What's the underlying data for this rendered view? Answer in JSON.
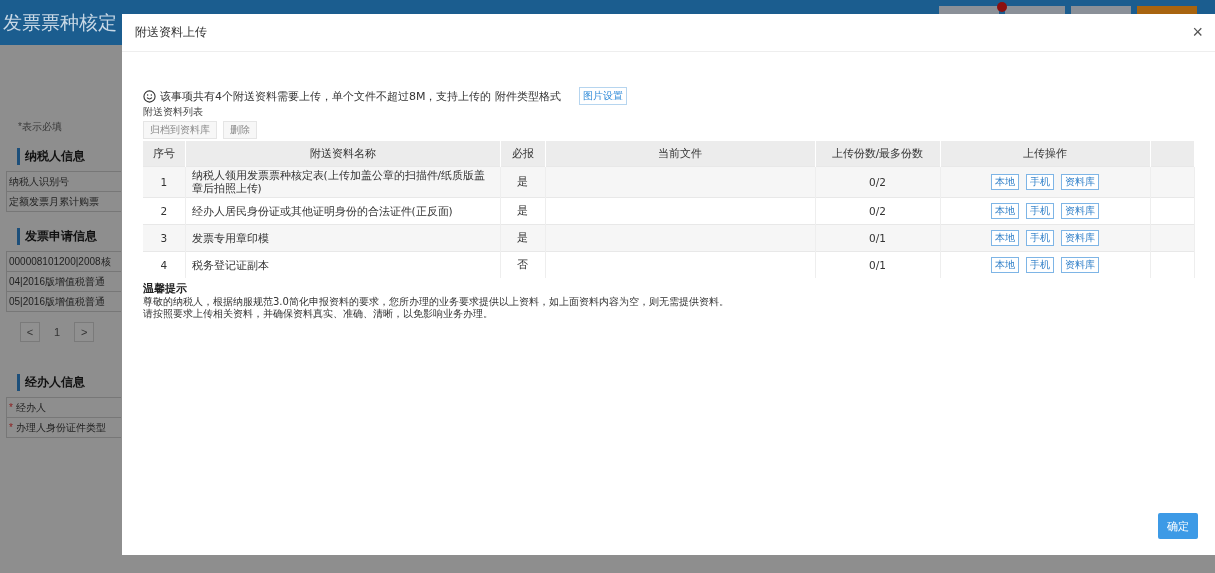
{
  "page": {
    "title": "发票票种核定",
    "required_note": "*表示必填",
    "required_symbol": "*",
    "sections": [
      {
        "title": "纳税人信息",
        "rows": [
          {
            "label": "纳税人识别号",
            "required": false
          },
          {
            "label": "定额发票月累计购票",
            "required": false
          }
        ]
      },
      {
        "title": "发票申请信息",
        "rows": [
          {
            "label": "000008101200|2008核",
            "required": false
          },
          {
            "label": "04|2016版增值税普通",
            "required": false
          },
          {
            "label": "05|2016版增值税普通",
            "required": false
          }
        ],
        "pager": {
          "prev": "<",
          "page": "1",
          "next": ">"
        }
      },
      {
        "title": "经办人信息",
        "rows": [
          {
            "label": "经办人",
            "required": true
          },
          {
            "label": "办理人身份证件类型",
            "required": true
          }
        ]
      }
    ]
  },
  "dialog": {
    "title": "附送资料上传",
    "close": "×",
    "notice": "该事项共有4个附送资料需要上传，单个文件不超过8M，支持上传的 附件类型格式",
    "image_settings": "图片设置",
    "list_title": "附送资料列表",
    "toolbar": [
      {
        "label": "归档到资料库",
        "disabled": true
      },
      {
        "label": "删除",
        "disabled": true
      }
    ],
    "table": {
      "columns": [
        "序号",
        "附送资料名称",
        "必报",
        "当前文件",
        "上传份数/最多份数",
        "上传操作"
      ],
      "rows": [
        {
          "index": "1",
          "name": "纳税人领用发票票种核定表(上传加盖公章的扫描件/纸质版盖章后拍照上传)",
          "required": "是",
          "count": "0/2",
          "actions": [
            "本地",
            "手机",
            "资料库"
          ]
        },
        {
          "index": "2",
          "name": "经办人居民身份证或其他证明身份的合法证件(正反面)",
          "required": "是",
          "count": "0/2",
          "actions": [
            "本地",
            "手机",
            "资料库"
          ]
        },
        {
          "index": "3",
          "name": "发票专用章印模",
          "required": "是",
          "count": "0/1",
          "actions": [
            "本地",
            "手机",
            "资料库"
          ]
        },
        {
          "index": "4",
          "name": "税务登记证副本",
          "required": "否",
          "count": "0/1",
          "actions": [
            "本地",
            "手机",
            "资料库"
          ]
        }
      ]
    },
    "tips_title": "温馨提示",
    "tips": [
      "尊敬的纳税人，根据纳服规范3.0简化申报资料的要求，您所办理的业务要求提供以上资料，如上面资料内容为空，则无需提供资料。",
      "请按照要求上传相关资料，并确保资料真实、准确、清晰，以免影响业务办理。"
    ],
    "confirm": "确定"
  }
}
